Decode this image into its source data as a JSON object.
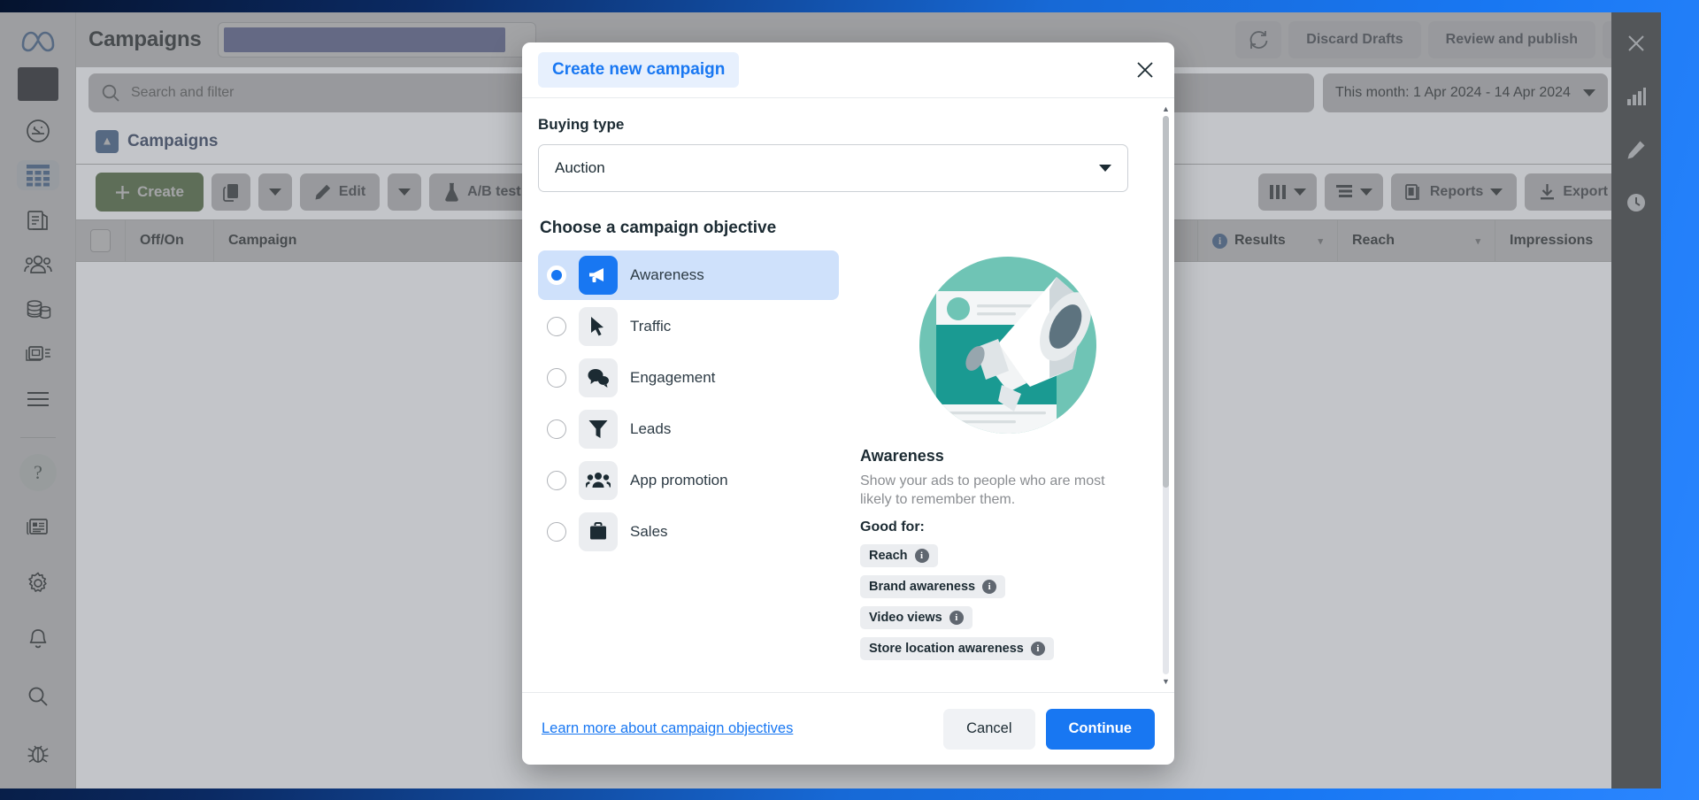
{
  "window": {
    "page_title": "Campaigns",
    "account_selector_value": ""
  },
  "top_actions": {
    "refresh_icon": "refresh-icon",
    "discard_drafts": "Discard Drafts",
    "review_and_publish": "Review and publish",
    "more_label": "•••"
  },
  "search": {
    "placeholder": "Search and filter",
    "icon": "search-icon",
    "date_range": "This month: 1 Apr 2024 - 14 Apr 2024"
  },
  "breadcrumb": {
    "icon": "campaigns-folder-icon",
    "label": "Campaigns"
  },
  "toolbar": {
    "create": "Create",
    "duplicate_icon": "duplicate-icon",
    "edit": "Edit",
    "ab_test": "A/B test",
    "columns_icon": "columns-icon",
    "breakdown_icon": "breakdown-icon",
    "reports": "Reports",
    "export": "Export"
  },
  "table": {
    "columns": [
      "Off/On",
      "Campaign",
      "Results",
      "Reach",
      "Impressions"
    ]
  },
  "sidebar": {
    "items": [
      {
        "name": "account-tile",
        "icon": "account-square-icon"
      },
      {
        "name": "dashboard",
        "icon": "speedometer-icon"
      },
      {
        "name": "campaigns-table",
        "icon": "table-grid-icon",
        "active": true
      },
      {
        "name": "pages",
        "icon": "pages-icon"
      },
      {
        "name": "audiences",
        "icon": "audiences-icon"
      },
      {
        "name": "billing",
        "icon": "billing-coins-icon"
      },
      {
        "name": "ads-library",
        "icon": "media-icon"
      },
      {
        "name": "all-tools",
        "icon": "hamburger-icon"
      }
    ],
    "bottom_items": [
      {
        "name": "help",
        "icon": "question-mark-icon"
      },
      {
        "name": "news",
        "icon": "newspaper-icon"
      },
      {
        "name": "settings",
        "icon": "gear-icon"
      },
      {
        "name": "notifications",
        "icon": "bell-icon"
      },
      {
        "name": "search",
        "icon": "search-icon"
      },
      {
        "name": "report-bug",
        "icon": "bug-icon"
      }
    ]
  },
  "right_rail": {
    "items": [
      {
        "name": "close-panel",
        "icon": "close-x-icon"
      },
      {
        "name": "analytics",
        "icon": "bar-chart-icon"
      },
      {
        "name": "edit",
        "icon": "pencil-icon"
      },
      {
        "name": "history",
        "icon": "clock-icon"
      }
    ]
  },
  "modal": {
    "title": "Create new campaign",
    "close_icon": "close-x-icon",
    "buying_type_label": "Buying type",
    "buying_type_value": "Auction",
    "objective_heading": "Choose a campaign objective",
    "objectives": [
      {
        "label": "Awareness",
        "icon": "megaphone-icon",
        "selected": true
      },
      {
        "label": "Traffic",
        "icon": "cursor-icon",
        "selected": false
      },
      {
        "label": "Engagement",
        "icon": "chat-bubbles-icon",
        "selected": false
      },
      {
        "label": "Leads",
        "icon": "funnel-icon",
        "selected": false
      },
      {
        "label": "App promotion",
        "icon": "people-icon",
        "selected": false
      },
      {
        "label": "Sales",
        "icon": "briefcase-icon",
        "selected": false
      }
    ],
    "detail": {
      "illustration": "megaphone-illustration",
      "title": "Awareness",
      "description": "Show your ads to people who are most likely to remember them.",
      "good_for_label": "Good for:",
      "good_for": [
        "Reach",
        "Brand awareness",
        "Video views",
        "Store location awareness"
      ]
    },
    "footer": {
      "learn_more": "Learn more about campaign objectives",
      "cancel": "Cancel",
      "continue": "Continue"
    }
  },
  "colors": {
    "brand_blue": "#1877f2",
    "create_green": "#3d8b0f",
    "selected_row": "#cfe1fb",
    "illustration_teal": "#6fc4b5",
    "illustration_teal_dark": "#1a9a92"
  }
}
